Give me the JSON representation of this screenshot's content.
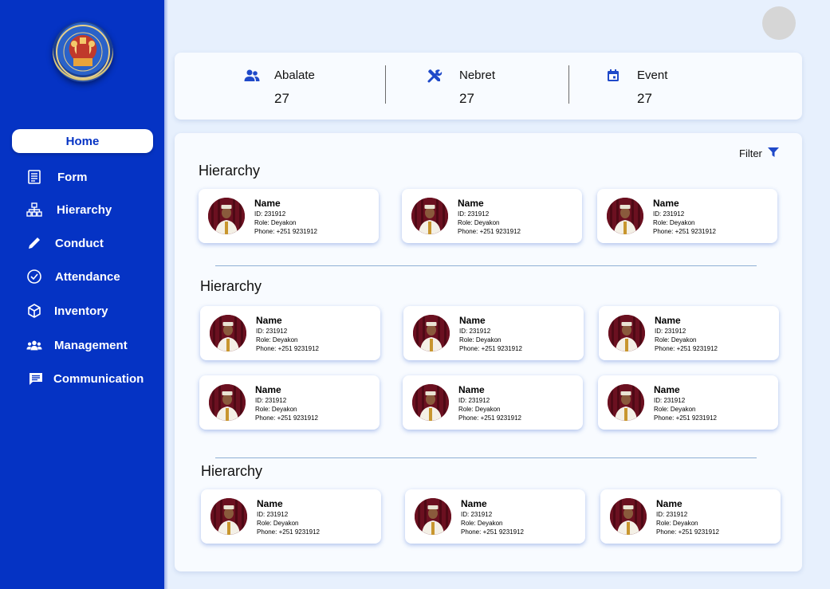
{
  "sidebar": {
    "home_label": "Home",
    "items": [
      {
        "label": "Form",
        "icon": "form-icon"
      },
      {
        "label": "Hierarchy",
        "icon": "hierarchy-icon"
      },
      {
        "label": "Conduct",
        "icon": "pencil-icon"
      },
      {
        "label": "Attendance",
        "icon": "check-circle-icon"
      },
      {
        "label": "Inventory",
        "icon": "box-icon"
      },
      {
        "label": "Management",
        "icon": "people-icon"
      },
      {
        "label": "Communication",
        "icon": "chat-icon"
      }
    ]
  },
  "stats": [
    {
      "label": "Abalate",
      "value": "27",
      "icon": "users-icon"
    },
    {
      "label": "Nebret",
      "value": "27",
      "icon": "tools-icon"
    },
    {
      "label": "Event",
      "value": "27",
      "icon": "calendar-icon"
    }
  ],
  "filter_label": "Filter",
  "sections": [
    {
      "title": "Hierarchy"
    },
    {
      "title": "Hierarchy"
    },
    {
      "title": "Hierarchy"
    }
  ],
  "card": {
    "name": "Name",
    "id": "ID: 231912",
    "role": "Role: Deyakon",
    "phone": "Phone: +251 9231912"
  },
  "colors": {
    "sidebar": "#0533c4",
    "background": "#e7f0fd",
    "panel": "#f8fbff",
    "accent": "#1f49c9"
  }
}
